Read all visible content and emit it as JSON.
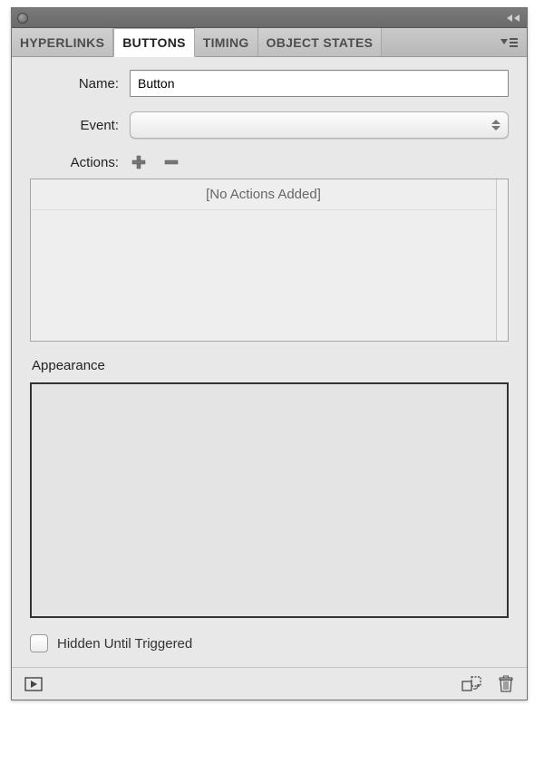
{
  "tabs": {
    "hyperlinks": "HYPERLINKS",
    "buttons": "BUTTONS",
    "timing": "TIMING",
    "object_states": "OBJECT STATES",
    "active": "buttons"
  },
  "fields": {
    "name_label": "Name:",
    "name_value": "Button",
    "event_label": "Event:",
    "event_value": "",
    "actions_label": "Actions:",
    "actions_placeholder": "[No Actions Added]"
  },
  "appearance": {
    "label": "Appearance"
  },
  "hidden_checkbox": {
    "label": "Hidden Until Triggered",
    "checked": false
  }
}
